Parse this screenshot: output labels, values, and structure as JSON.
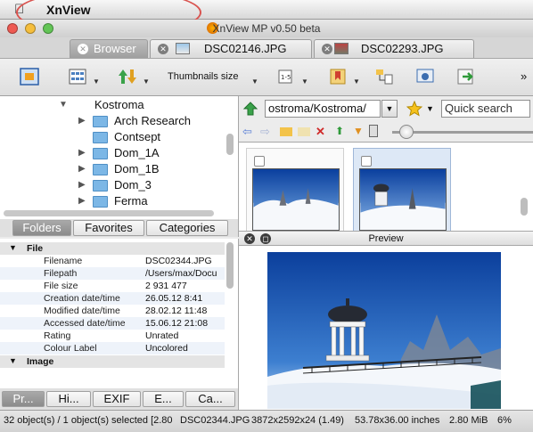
{
  "menubar": {
    "app_name": "XnView",
    "apple_icon": "apple-icon"
  },
  "window": {
    "title": "XnView MP v0.50 beta"
  },
  "tabs": [
    {
      "label": "Browser",
      "active": true
    },
    {
      "label": "DSC02146.JPG",
      "active": false
    },
    {
      "label": "DSC02293.JPG",
      "active": false
    }
  ],
  "toolbar": {
    "thumbnails_size_label": "Thumbnails size",
    "overflow": "»"
  },
  "tree": {
    "root": "Kostroma",
    "items": [
      "Arch Research",
      "Contsept",
      "Dom_1A",
      "Dom_1B",
      "Dom_3",
      "Ferma"
    ]
  },
  "panel_tabs": [
    "Folders",
    "Favorites",
    "Categories"
  ],
  "info": {
    "file_section": "File",
    "rows": [
      {
        "key": "Filename",
        "value": "DSC02344.JPG"
      },
      {
        "key": "Filepath",
        "value": "/Users/max/Docu"
      },
      {
        "key": "File size",
        "value": "2 931 477"
      },
      {
        "key": "Creation date/time",
        "value": "26.05.12 8:41"
      },
      {
        "key": "Modified date/time",
        "value": "28.02.12 11:48"
      },
      {
        "key": "Accessed date/time",
        "value": "15.06.12 21:08"
      },
      {
        "key": "Rating",
        "value": "Unrated"
      },
      {
        "key": "Colour Label",
        "value": "Uncolored"
      }
    ],
    "image_section": "Image"
  },
  "bottom_tabs": [
    "Pr...",
    "Hi...",
    "EXIF",
    "E...",
    "Ca..."
  ],
  "address": {
    "path": "ostroma/Kostroma/",
    "search_placeholder": "Quick search"
  },
  "preview": {
    "title": "Preview"
  },
  "status": {
    "objects": "32 object(s) / 1 object(s) selected [2.80",
    "filename": "DSC02344.JPG",
    "dimensions": "3872x2592x24 (1.49)",
    "print_size": "53.78x36.00 inches",
    "size": "2.80 MiB",
    "zoom": "6%"
  },
  "colors": {
    "highlight": "#d9534f",
    "folder": "#7cb7e6",
    "sky": "#1a5cc0"
  }
}
